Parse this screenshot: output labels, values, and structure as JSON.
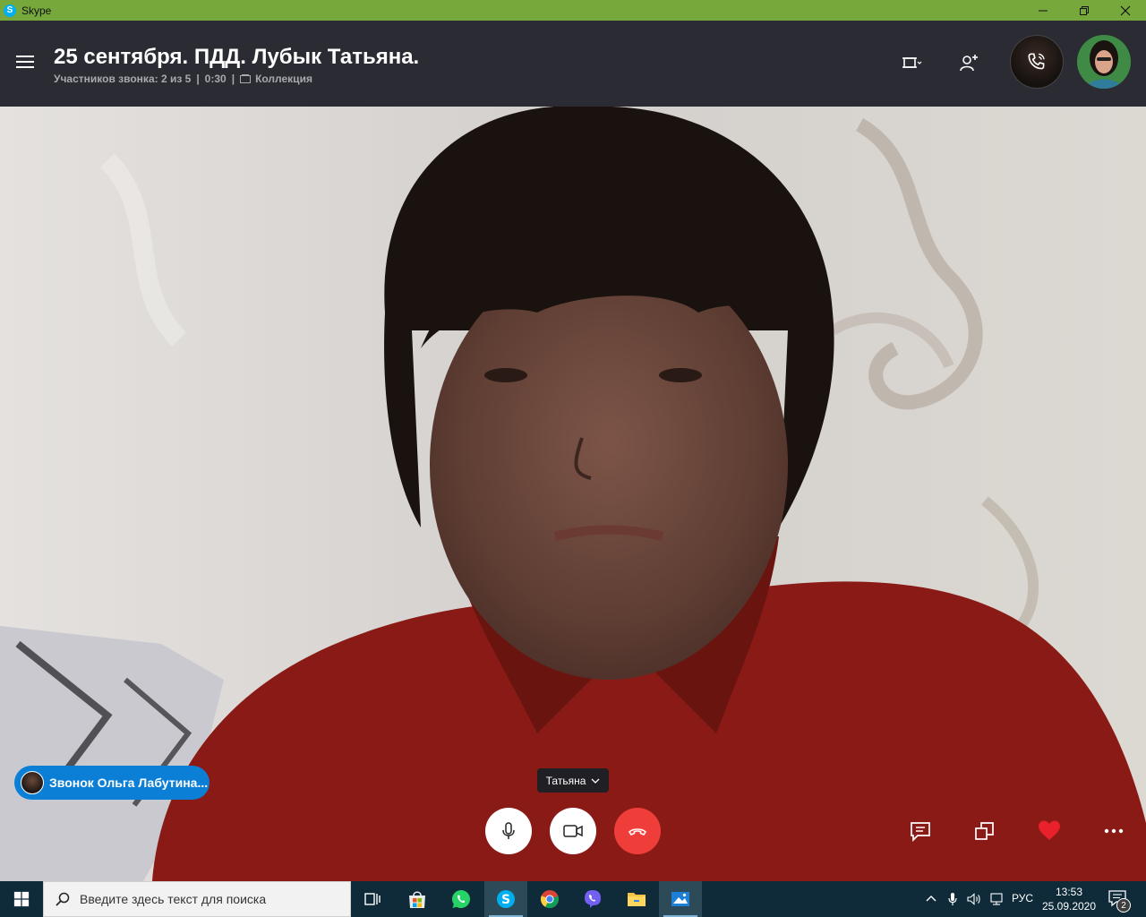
{
  "window": {
    "app_title": "Skype",
    "icon": "skype-icon"
  },
  "header": {
    "call_title": "25 сентября. ПДД. Лубык Татьяна.",
    "participants": "Участников звонка: 2 из 5",
    "duration": "0:30",
    "separator": "|",
    "gallery_label": "Коллекция"
  },
  "call": {
    "speaker_name": "Татьяна",
    "incoming_notification": "Звонок Ольга Лабутина..."
  },
  "colors": {
    "titlebar": "#77a83c",
    "header": "#2b2c33",
    "end_call": "#ef3e3a",
    "notification": "#0b7fd6",
    "heart": "#e8212b",
    "taskbar": "#0f2a38"
  },
  "taskbar": {
    "search_placeholder": "Введите здесь текст для поиска",
    "language": "РУС",
    "time": "13:53",
    "date": "25.09.2020",
    "notification_count": "2"
  }
}
